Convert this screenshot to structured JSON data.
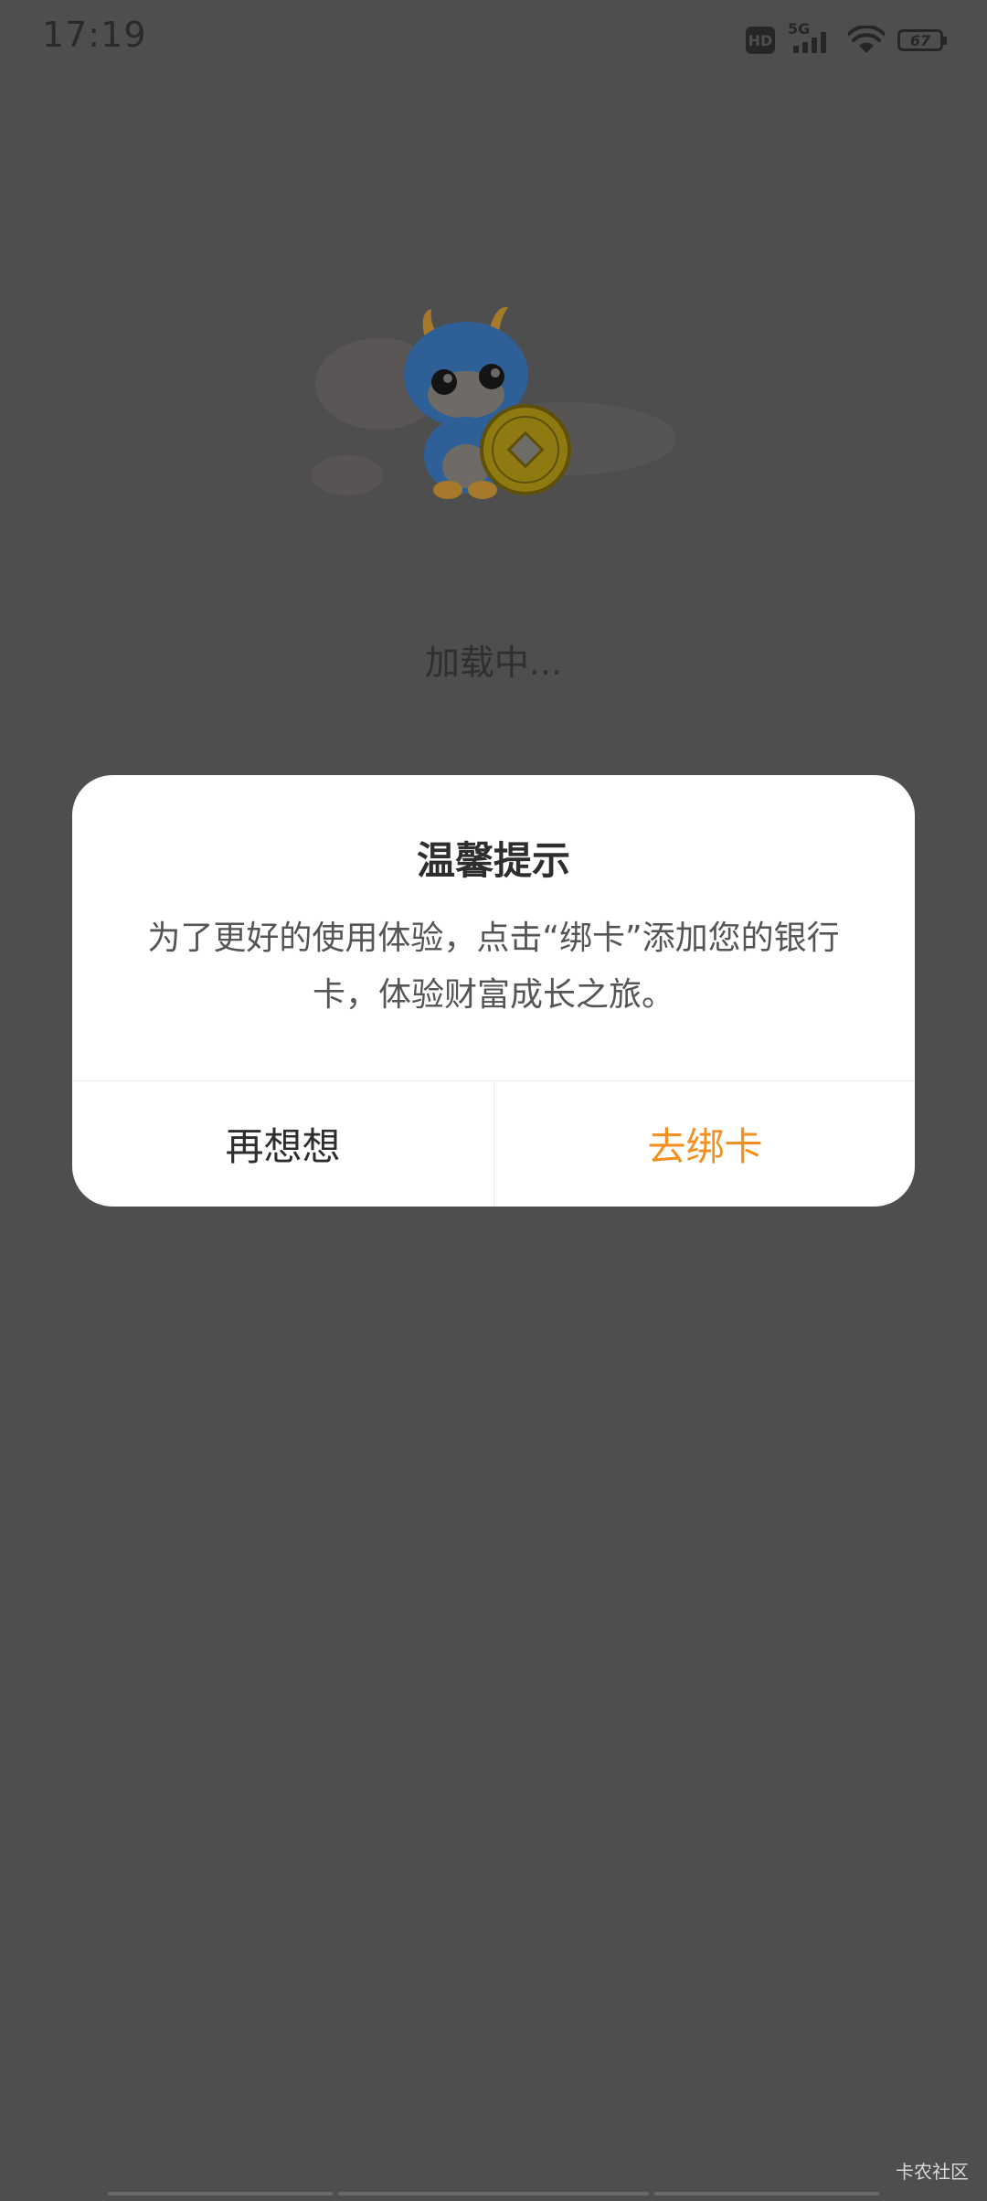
{
  "status_bar": {
    "time": "17:19",
    "hd_label": "HD",
    "network_label": "5G",
    "battery_level": "67",
    "icons": [
      "hd-icon",
      "signal-5g-icon",
      "wifi-icon",
      "battery-icon"
    ]
  },
  "loading": {
    "mascot_icon": "dragon-mascot-with-coin",
    "text": "加载中..."
  },
  "dialog": {
    "title": "温馨提示",
    "message": "为了更好的使用体验，点击“绑卡”添加您的银行卡，体验财富成长之旅。",
    "cancel_label": "再想想",
    "confirm_label": "去绑卡",
    "confirm_color": "#f29121"
  },
  "watermark": "卡农社区"
}
